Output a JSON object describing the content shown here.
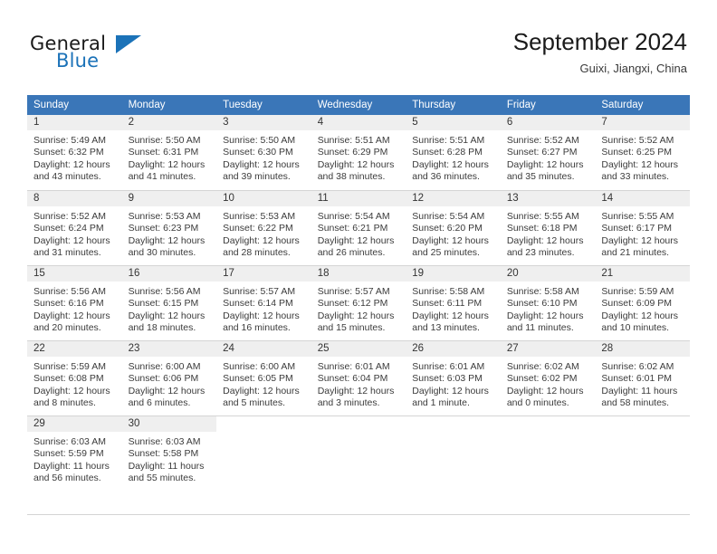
{
  "brand": {
    "name_primary": "General",
    "name_secondary": "Blue",
    "accent_color": "#1b72b8"
  },
  "header": {
    "title": "September 2024",
    "subtitle": "Guixi, Jiangxi, China"
  },
  "theme": {
    "header_row_bg": "#3a76b8",
    "daynum_band_bg": "#efefef",
    "grid_line": "#d4d4d4",
    "text": "#3b3b3b"
  },
  "weekday_headers": [
    "Sunday",
    "Monday",
    "Tuesday",
    "Wednesday",
    "Thursday",
    "Friday",
    "Saturday"
  ],
  "weeks": [
    [
      {
        "day": "1",
        "sunrise": "Sunrise: 5:49 AM",
        "sunset": "Sunset: 6:32 PM",
        "daylight1": "Daylight: 12 hours",
        "daylight2": "and 43 minutes."
      },
      {
        "day": "2",
        "sunrise": "Sunrise: 5:50 AM",
        "sunset": "Sunset: 6:31 PM",
        "daylight1": "Daylight: 12 hours",
        "daylight2": "and 41 minutes."
      },
      {
        "day": "3",
        "sunrise": "Sunrise: 5:50 AM",
        "sunset": "Sunset: 6:30 PM",
        "daylight1": "Daylight: 12 hours",
        "daylight2": "and 39 minutes."
      },
      {
        "day": "4",
        "sunrise": "Sunrise: 5:51 AM",
        "sunset": "Sunset: 6:29 PM",
        "daylight1": "Daylight: 12 hours",
        "daylight2": "and 38 minutes."
      },
      {
        "day": "5",
        "sunrise": "Sunrise: 5:51 AM",
        "sunset": "Sunset: 6:28 PM",
        "daylight1": "Daylight: 12 hours",
        "daylight2": "and 36 minutes."
      },
      {
        "day": "6",
        "sunrise": "Sunrise: 5:52 AM",
        "sunset": "Sunset: 6:27 PM",
        "daylight1": "Daylight: 12 hours",
        "daylight2": "and 35 minutes."
      },
      {
        "day": "7",
        "sunrise": "Sunrise: 5:52 AM",
        "sunset": "Sunset: 6:25 PM",
        "daylight1": "Daylight: 12 hours",
        "daylight2": "and 33 minutes."
      }
    ],
    [
      {
        "day": "8",
        "sunrise": "Sunrise: 5:52 AM",
        "sunset": "Sunset: 6:24 PM",
        "daylight1": "Daylight: 12 hours",
        "daylight2": "and 31 minutes."
      },
      {
        "day": "9",
        "sunrise": "Sunrise: 5:53 AM",
        "sunset": "Sunset: 6:23 PM",
        "daylight1": "Daylight: 12 hours",
        "daylight2": "and 30 minutes."
      },
      {
        "day": "10",
        "sunrise": "Sunrise: 5:53 AM",
        "sunset": "Sunset: 6:22 PM",
        "daylight1": "Daylight: 12 hours",
        "daylight2": "and 28 minutes."
      },
      {
        "day": "11",
        "sunrise": "Sunrise: 5:54 AM",
        "sunset": "Sunset: 6:21 PM",
        "daylight1": "Daylight: 12 hours",
        "daylight2": "and 26 minutes."
      },
      {
        "day": "12",
        "sunrise": "Sunrise: 5:54 AM",
        "sunset": "Sunset: 6:20 PM",
        "daylight1": "Daylight: 12 hours",
        "daylight2": "and 25 minutes."
      },
      {
        "day": "13",
        "sunrise": "Sunrise: 5:55 AM",
        "sunset": "Sunset: 6:18 PM",
        "daylight1": "Daylight: 12 hours",
        "daylight2": "and 23 minutes."
      },
      {
        "day": "14",
        "sunrise": "Sunrise: 5:55 AM",
        "sunset": "Sunset: 6:17 PM",
        "daylight1": "Daylight: 12 hours",
        "daylight2": "and 21 minutes."
      }
    ],
    [
      {
        "day": "15",
        "sunrise": "Sunrise: 5:56 AM",
        "sunset": "Sunset: 6:16 PM",
        "daylight1": "Daylight: 12 hours",
        "daylight2": "and 20 minutes."
      },
      {
        "day": "16",
        "sunrise": "Sunrise: 5:56 AM",
        "sunset": "Sunset: 6:15 PM",
        "daylight1": "Daylight: 12 hours",
        "daylight2": "and 18 minutes."
      },
      {
        "day": "17",
        "sunrise": "Sunrise: 5:57 AM",
        "sunset": "Sunset: 6:14 PM",
        "daylight1": "Daylight: 12 hours",
        "daylight2": "and 16 minutes."
      },
      {
        "day": "18",
        "sunrise": "Sunrise: 5:57 AM",
        "sunset": "Sunset: 6:12 PM",
        "daylight1": "Daylight: 12 hours",
        "daylight2": "and 15 minutes."
      },
      {
        "day": "19",
        "sunrise": "Sunrise: 5:58 AM",
        "sunset": "Sunset: 6:11 PM",
        "daylight1": "Daylight: 12 hours",
        "daylight2": "and 13 minutes."
      },
      {
        "day": "20",
        "sunrise": "Sunrise: 5:58 AM",
        "sunset": "Sunset: 6:10 PM",
        "daylight1": "Daylight: 12 hours",
        "daylight2": "and 11 minutes."
      },
      {
        "day": "21",
        "sunrise": "Sunrise: 5:59 AM",
        "sunset": "Sunset: 6:09 PM",
        "daylight1": "Daylight: 12 hours",
        "daylight2": "and 10 minutes."
      }
    ],
    [
      {
        "day": "22",
        "sunrise": "Sunrise: 5:59 AM",
        "sunset": "Sunset: 6:08 PM",
        "daylight1": "Daylight: 12 hours",
        "daylight2": "and 8 minutes."
      },
      {
        "day": "23",
        "sunrise": "Sunrise: 6:00 AM",
        "sunset": "Sunset: 6:06 PM",
        "daylight1": "Daylight: 12 hours",
        "daylight2": "and 6 minutes."
      },
      {
        "day": "24",
        "sunrise": "Sunrise: 6:00 AM",
        "sunset": "Sunset: 6:05 PM",
        "daylight1": "Daylight: 12 hours",
        "daylight2": "and 5 minutes."
      },
      {
        "day": "25",
        "sunrise": "Sunrise: 6:01 AM",
        "sunset": "Sunset: 6:04 PM",
        "daylight1": "Daylight: 12 hours",
        "daylight2": "and 3 minutes."
      },
      {
        "day": "26",
        "sunrise": "Sunrise: 6:01 AM",
        "sunset": "Sunset: 6:03 PM",
        "daylight1": "Daylight: 12 hours",
        "daylight2": "and 1 minute."
      },
      {
        "day": "27",
        "sunrise": "Sunrise: 6:02 AM",
        "sunset": "Sunset: 6:02 PM",
        "daylight1": "Daylight: 12 hours",
        "daylight2": "and 0 minutes."
      },
      {
        "day": "28",
        "sunrise": "Sunrise: 6:02 AM",
        "sunset": "Sunset: 6:01 PM",
        "daylight1": "Daylight: 11 hours",
        "daylight2": "and 58 minutes."
      }
    ],
    [
      {
        "day": "29",
        "sunrise": "Sunrise: 6:03 AM",
        "sunset": "Sunset: 5:59 PM",
        "daylight1": "Daylight: 11 hours",
        "daylight2": "and 56 minutes."
      },
      {
        "day": "30",
        "sunrise": "Sunrise: 6:03 AM",
        "sunset": "Sunset: 5:58 PM",
        "daylight1": "Daylight: 11 hours",
        "daylight2": "and 55 minutes."
      },
      {
        "day": "",
        "sunrise": "",
        "sunset": "",
        "daylight1": "",
        "daylight2": ""
      },
      {
        "day": "",
        "sunrise": "",
        "sunset": "",
        "daylight1": "",
        "daylight2": ""
      },
      {
        "day": "",
        "sunrise": "",
        "sunset": "",
        "daylight1": "",
        "daylight2": ""
      },
      {
        "day": "",
        "sunrise": "",
        "sunset": "",
        "daylight1": "",
        "daylight2": ""
      },
      {
        "day": "",
        "sunrise": "",
        "sunset": "",
        "daylight1": "",
        "daylight2": ""
      }
    ]
  ]
}
